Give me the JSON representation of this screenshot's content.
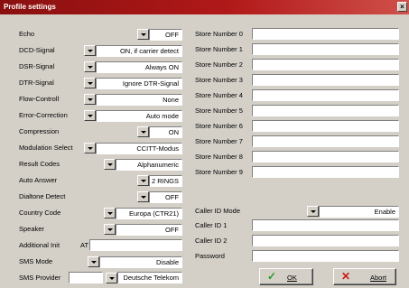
{
  "window": {
    "title": "Profile settings",
    "close_label": "×"
  },
  "left": {
    "echo": {
      "label": "Echo",
      "value": "OFF"
    },
    "dcd": {
      "label": "DCD-Signal",
      "value": "ON, if carrier detect"
    },
    "dsr": {
      "label": "DSR-Signal",
      "value": "Always ON"
    },
    "dtr": {
      "label": "DTR-Signal",
      "value": "Ignore DTR-Signal"
    },
    "flow": {
      "label": "Flow-Controll",
      "value": "None"
    },
    "error": {
      "label": "Error-Correction",
      "value": "Auto mode"
    },
    "compression": {
      "label": "Compression",
      "value": "ON"
    },
    "modulation": {
      "label": "Modulation Select",
      "value": "CCITT-Modus"
    },
    "result": {
      "label": "Result Codes",
      "value": "Alphanumeric"
    },
    "autoanswer": {
      "label": "Auto Answer",
      "value": "2 RINGS"
    },
    "dialtone": {
      "label": "Dialtone Detect",
      "value": "OFF"
    },
    "country": {
      "label": "Country Code",
      "value": "Europa (CTR21)"
    },
    "speaker": {
      "label": "Speaker",
      "value": "OFF"
    },
    "additional": {
      "label": "Additional Init",
      "prefix": "AT",
      "value": ""
    },
    "sms_mode": {
      "label": "SMS Mode",
      "value": "Disable"
    },
    "sms_provider": {
      "label": "SMS Provider",
      "number": "",
      "value": "Deutsche Telekom"
    }
  },
  "right": {
    "store_numbers": [
      {
        "label": "Store Number 0",
        "value": ""
      },
      {
        "label": "Store Number 1",
        "value": ""
      },
      {
        "label": "Store Number 2",
        "value": ""
      },
      {
        "label": "Store Number 3",
        "value": ""
      },
      {
        "label": "Store Number 4",
        "value": ""
      },
      {
        "label": "Store Number 5",
        "value": ""
      },
      {
        "label": "Store Number 6",
        "value": ""
      },
      {
        "label": "Store Number 7",
        "value": ""
      },
      {
        "label": "Store Number 8",
        "value": ""
      },
      {
        "label": "Store Number 9",
        "value": ""
      }
    ],
    "callerid_mode": {
      "label": "Caller ID Mode",
      "value": "Enable"
    },
    "callerid1": {
      "label": "Caller ID 1",
      "value": ""
    },
    "callerid2": {
      "label": "Caller ID 2",
      "value": ""
    },
    "password": {
      "label": "Password",
      "value": ""
    }
  },
  "buttons": {
    "ok": {
      "label": "OK",
      "icon": "check-icon",
      "color": "#2a9a2a"
    },
    "abort": {
      "label": "Abort",
      "icon": "x-icon",
      "color": "#cc1a1a"
    }
  }
}
